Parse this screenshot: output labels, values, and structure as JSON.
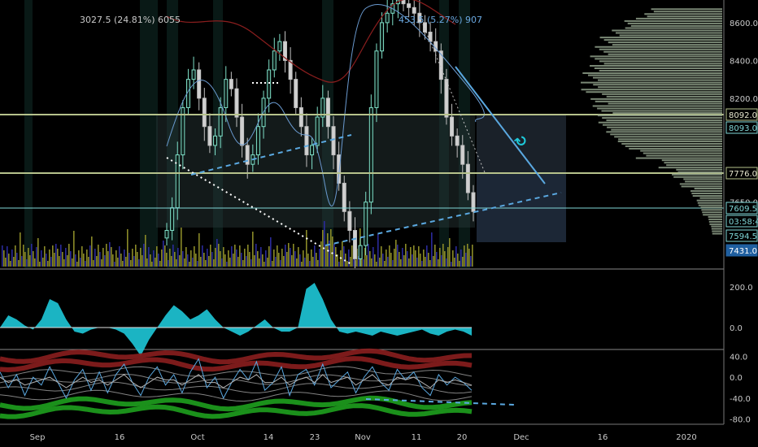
{
  "annotations": {
    "left_measure": "3027.5 (24.81%) 6055",
    "right_measure": "453.5 (5.27%) 907",
    "arrow_glyph": "↻"
  },
  "price_axis": {
    "ticks": [
      "8600.0",
      "8400.0",
      "8200.0",
      "7650.0"
    ],
    "tags": [
      {
        "text": "8092.0",
        "style": "hline-box",
        "color": "#b6c28b",
        "value": 8092.0
      },
      {
        "text": "8093.0",
        "style": "teal-box",
        "color": "#7fd6d6",
        "value": 8093.0
      },
      {
        "text": "7776.0",
        "style": "hline-box",
        "color": "#b6c28b",
        "value": 7776.0
      },
      {
        "text": "7609.5",
        "style": "teal-box",
        "color": "#7fd6d6",
        "value": 7609.5
      },
      {
        "text": "03:58:47",
        "style": "teal-box",
        "color": "#7fd6d6"
      },
      {
        "text": "7594.5",
        "style": "teal-box",
        "color": "#7fd6d6",
        "value": 7594.5
      },
      {
        "text": "7431.0",
        "style": "filled",
        "color": "#1f5fa0",
        "value": 7431.0
      }
    ]
  },
  "osc1_axis": {
    "ticks": [
      "200.0",
      "0.0"
    ]
  },
  "osc2_axis": {
    "ticks": [
      "40.0",
      "0.0",
      "-40.0",
      "-80.0"
    ]
  },
  "time_axis": {
    "labels": [
      "Sep",
      "16",
      "Oct",
      "14",
      "23",
      "Nov",
      "11",
      "20",
      "Dec",
      "16",
      "2020"
    ]
  },
  "colors": {
    "background": "#000000",
    "accent_cyan": "#1ec8d8",
    "hline_olive": "#b6c28b",
    "trend_blue": "#5aa8e0",
    "volume_olive": "#8a8a28",
    "volume_blue": "#2a2a9a",
    "histogram_green": "#8fa08a"
  },
  "chart_data": [
    {
      "type": "line",
      "panel": "price",
      "title": "",
      "ylim": [
        7300,
        8720
      ],
      "horizontal_levels": [
        8092.0,
        7776.0,
        7609.5
      ],
      "candles_close": [
        7500,
        7620,
        7900,
        8150,
        8300,
        8350,
        8200,
        8050,
        7950,
        8000,
        8150,
        8300,
        8250,
        8100,
        7950,
        7850,
        7900,
        8050,
        8200,
        8350,
        8450,
        8500,
        8400,
        8300,
        8150,
        8050,
        7900,
        7950,
        8100,
        8200,
        8050,
        7900,
        7750,
        7600,
        7500,
        7350,
        7420,
        7650,
        8150,
        8450,
        8600,
        8650,
        8700,
        8720,
        8700,
        8680,
        8650,
        8600,
        8550,
        8500,
        8450,
        8300,
        8100,
        8000,
        7950,
        7850,
        7700,
        7600
      ],
      "volume_profile": [
        {
          "price": 8650,
          "width": 0.55
        },
        {
          "price": 8600,
          "width": 0.68
        },
        {
          "price": 8550,
          "width": 0.78
        },
        {
          "price": 8500,
          "width": 0.85
        },
        {
          "price": 8450,
          "width": 0.9
        },
        {
          "price": 8400,
          "width": 0.95
        },
        {
          "price": 8350,
          "width": 0.97
        },
        {
          "price": 8300,
          "width": 1.0
        },
        {
          "price": 8250,
          "width": 0.98
        },
        {
          "price": 8200,
          "width": 0.93
        },
        {
          "price": 8150,
          "width": 0.9
        },
        {
          "price": 8100,
          "width": 0.88
        },
        {
          "price": 8050,
          "width": 0.86
        },
        {
          "price": 8000,
          "width": 0.82
        },
        {
          "price": 7950,
          "width": 0.75
        },
        {
          "price": 7900,
          "width": 0.6
        },
        {
          "price": 7850,
          "width": 0.45
        },
        {
          "price": 7800,
          "width": 0.35
        },
        {
          "price": 7750,
          "width": 0.3
        },
        {
          "price": 7700,
          "width": 0.22
        },
        {
          "price": 7650,
          "width": 0.18
        },
        {
          "price": 7600,
          "width": 0.15
        },
        {
          "price": 7550,
          "width": 0.1
        },
        {
          "price": 7500,
          "width": 0.08
        }
      ]
    },
    {
      "type": "area",
      "panel": "oscillator-1",
      "ylim": [
        -100,
        260
      ],
      "values": [
        0,
        60,
        40,
        10,
        -10,
        40,
        140,
        120,
        40,
        -20,
        -30,
        -10,
        0,
        0,
        -10,
        -30,
        -80,
        -140,
        -60,
        0,
        60,
        110,
        80,
        40,
        60,
        90,
        40,
        0,
        -20,
        -40,
        -20,
        10,
        40,
        0,
        -20,
        -20,
        0,
        190,
        220,
        140,
        40,
        -20,
        -30,
        -20,
        -30,
        -40,
        -20,
        -30,
        -40,
        -30,
        -20,
        -10,
        -30,
        -40,
        -20,
        -10,
        -20,
        -40
      ]
    },
    {
      "type": "line",
      "panel": "oscillator-2",
      "ylim": [
        -90,
        50
      ],
      "series": [
        {
          "name": "",
          "values": [
            10,
            -20,
            5,
            -35,
            0,
            -15,
            20,
            -10,
            -40,
            -5,
            15,
            -25,
            10,
            -30,
            5,
            25,
            -10,
            -35,
            0,
            20,
            -15,
            5,
            -30,
            10,
            35,
            -20,
            0,
            -40,
            -10,
            15,
            -5,
            30,
            -25,
            -10,
            20,
            -35,
            5,
            15,
            -15,
            25,
            -20,
            -5,
            10,
            -30,
            0,
            20,
            -10,
            -25,
            15,
            -5,
            10,
            -20,
            -35,
            5,
            -15,
            0,
            -10,
            -25
          ]
        },
        {
          "name": "",
          "values": [
            0,
            -10,
            -5,
            -15,
            -10,
            -5,
            0,
            -10,
            -20,
            -10,
            0,
            -10,
            -5,
            -15,
            -5,
            5,
            -10,
            -20,
            -10,
            0,
            -5,
            -5,
            -15,
            -5,
            5,
            -10,
            -10,
            -20,
            -10,
            0,
            -5,
            5,
            -10,
            -10,
            0,
            -15,
            -5,
            0,
            -10,
            5,
            -10,
            -5,
            0,
            -15,
            -5,
            5,
            -10,
            -15,
            0,
            -5,
            0,
            -10,
            -20,
            -5,
            -10,
            -5,
            -10,
            -15
          ]
        }
      ],
      "bands": [
        40,
        25,
        10,
        -5,
        -20,
        -35,
        -50,
        -65
      ]
    }
  ]
}
